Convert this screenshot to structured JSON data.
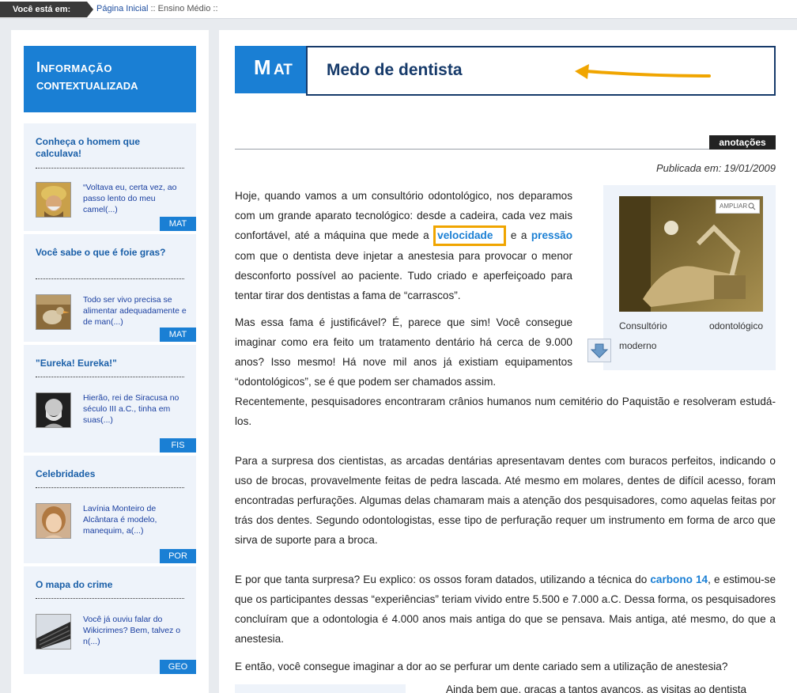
{
  "breadcrumb": {
    "label": "Você está em:",
    "home": "Página Inicial",
    "sep1": " :: ",
    "current": "Ensino Médio",
    "sep2": " ::"
  },
  "sidebar": {
    "header_line1": "Informação",
    "header_line2": "contextualizada",
    "cards": [
      {
        "title": "Conheça o homem que calculava!",
        "text": "“Voltava eu, certa vez, ao passo lento do meu camel(...)",
        "tag": "MAT",
        "thumb_icon": "turban-man-icon"
      },
      {
        "title": "Você sabe o que é foie gras?",
        "text": "Todo ser vivo precisa se alimentar adequadamente e de man(...)",
        "tag": "MAT",
        "thumb_icon": "bird-icon"
      },
      {
        "title": "\"Eureka! Eureka!\"",
        "text": "Hierão, rei de Siracusa no século III a.C., tinha em suas(...)",
        "tag": "FIS",
        "thumb_icon": "statue-bust-icon"
      },
      {
        "title": "Celebridades",
        "text": "Lavínia Monteiro de Alcântara é modelo, manequim, a(...)",
        "tag": "POR",
        "thumb_icon": "woman-portrait-icon"
      },
      {
        "title": "O mapa do crime",
        "text": " Você já ouviu falar do Wikicrimes? Bem, talvez o n(...)",
        "tag": "GEO",
        "thumb_icon": "keyboard-icon"
      }
    ]
  },
  "article": {
    "subject_m": "M",
    "subject_rest": "AT",
    "title": "Medo de dentista",
    "notes_label": "anotações",
    "published": "Publicada em: 19/01/2009",
    "p1a": "Hoje, quando vamos a um consultório odontológico, nos deparamos com um grande aparato tecnológico: desde a cadeira, cada vez mais confortável, até a máquina que mede a",
    "kw_velocidade": "velocidade",
    "p1b": "e a",
    "kw_pressao": "pressão",
    "p1c": "com que o dentista deve injetar a anestesia para provocar o menor desconforto possível ao paciente. Tudo criado e aperfeiçoado para tentar tirar dos dentistas a fama de “carrascos”.",
    "p2a": "Mas essa fama é justificável? É, parece que sim! Você consegue imaginar como era feito um tratamento dentário há cerca de 9.000 anos? Isso mesmo! Há nove mil anos já existiam equipamentos “odontológicos”, se é que podem ser chamados assim.",
    "p2b": "Recentemente, pesquisadores encontraram crânios humanos num cemitério do Paquistão e resolveram estudá-los.",
    "p3": "Para a surpresa dos cientistas, as arcadas dentárias apresentavam dentes com buracos perfeitos, indicando o uso de brocas, provavelmente feitas de pedra lascada. Até mesmo em molares, dentes de difícil acesso, foram encontradas perfurações. Algumas delas chamaram mais a atenção dos pesquisadores, como aquelas feitas por trás dos dentes. Segundo odontologistas, esse tipo de perfuração requer um instrumento em forma de arco que sirva de suporte para a broca.",
    "p4a": "E por que tanta surpresa? Eu explico: os ossos foram datados, utilizando a técnica do",
    "kw_carbono": "carbono 14",
    "p4b": ", e estimou-se que os participantes dessas “experiências” teriam vivido entre 5.500 e 7.000 a.C. Dessa forma, os pesquisadores concluíram que a odontologia é 4.000 anos mais antiga do que se pensava. Mais antiga, até mesmo, do que a anestesia.",
    "p5": "E então, você consegue imaginar a dor ao se perfurar um dente cariado sem a utilização de anestesia?",
    "p6_partial": "Ainda bem que, graças a tantos avanços, as visitas ao dentista"
  },
  "photo": {
    "ampliar": "AMPLIAR",
    "caption_line1": "Consultório odontológico",
    "caption_line2": "moderno"
  },
  "colors": {
    "accent": "#1a7fd4",
    "title": "#163a6a",
    "highlight": "#f0a500"
  }
}
